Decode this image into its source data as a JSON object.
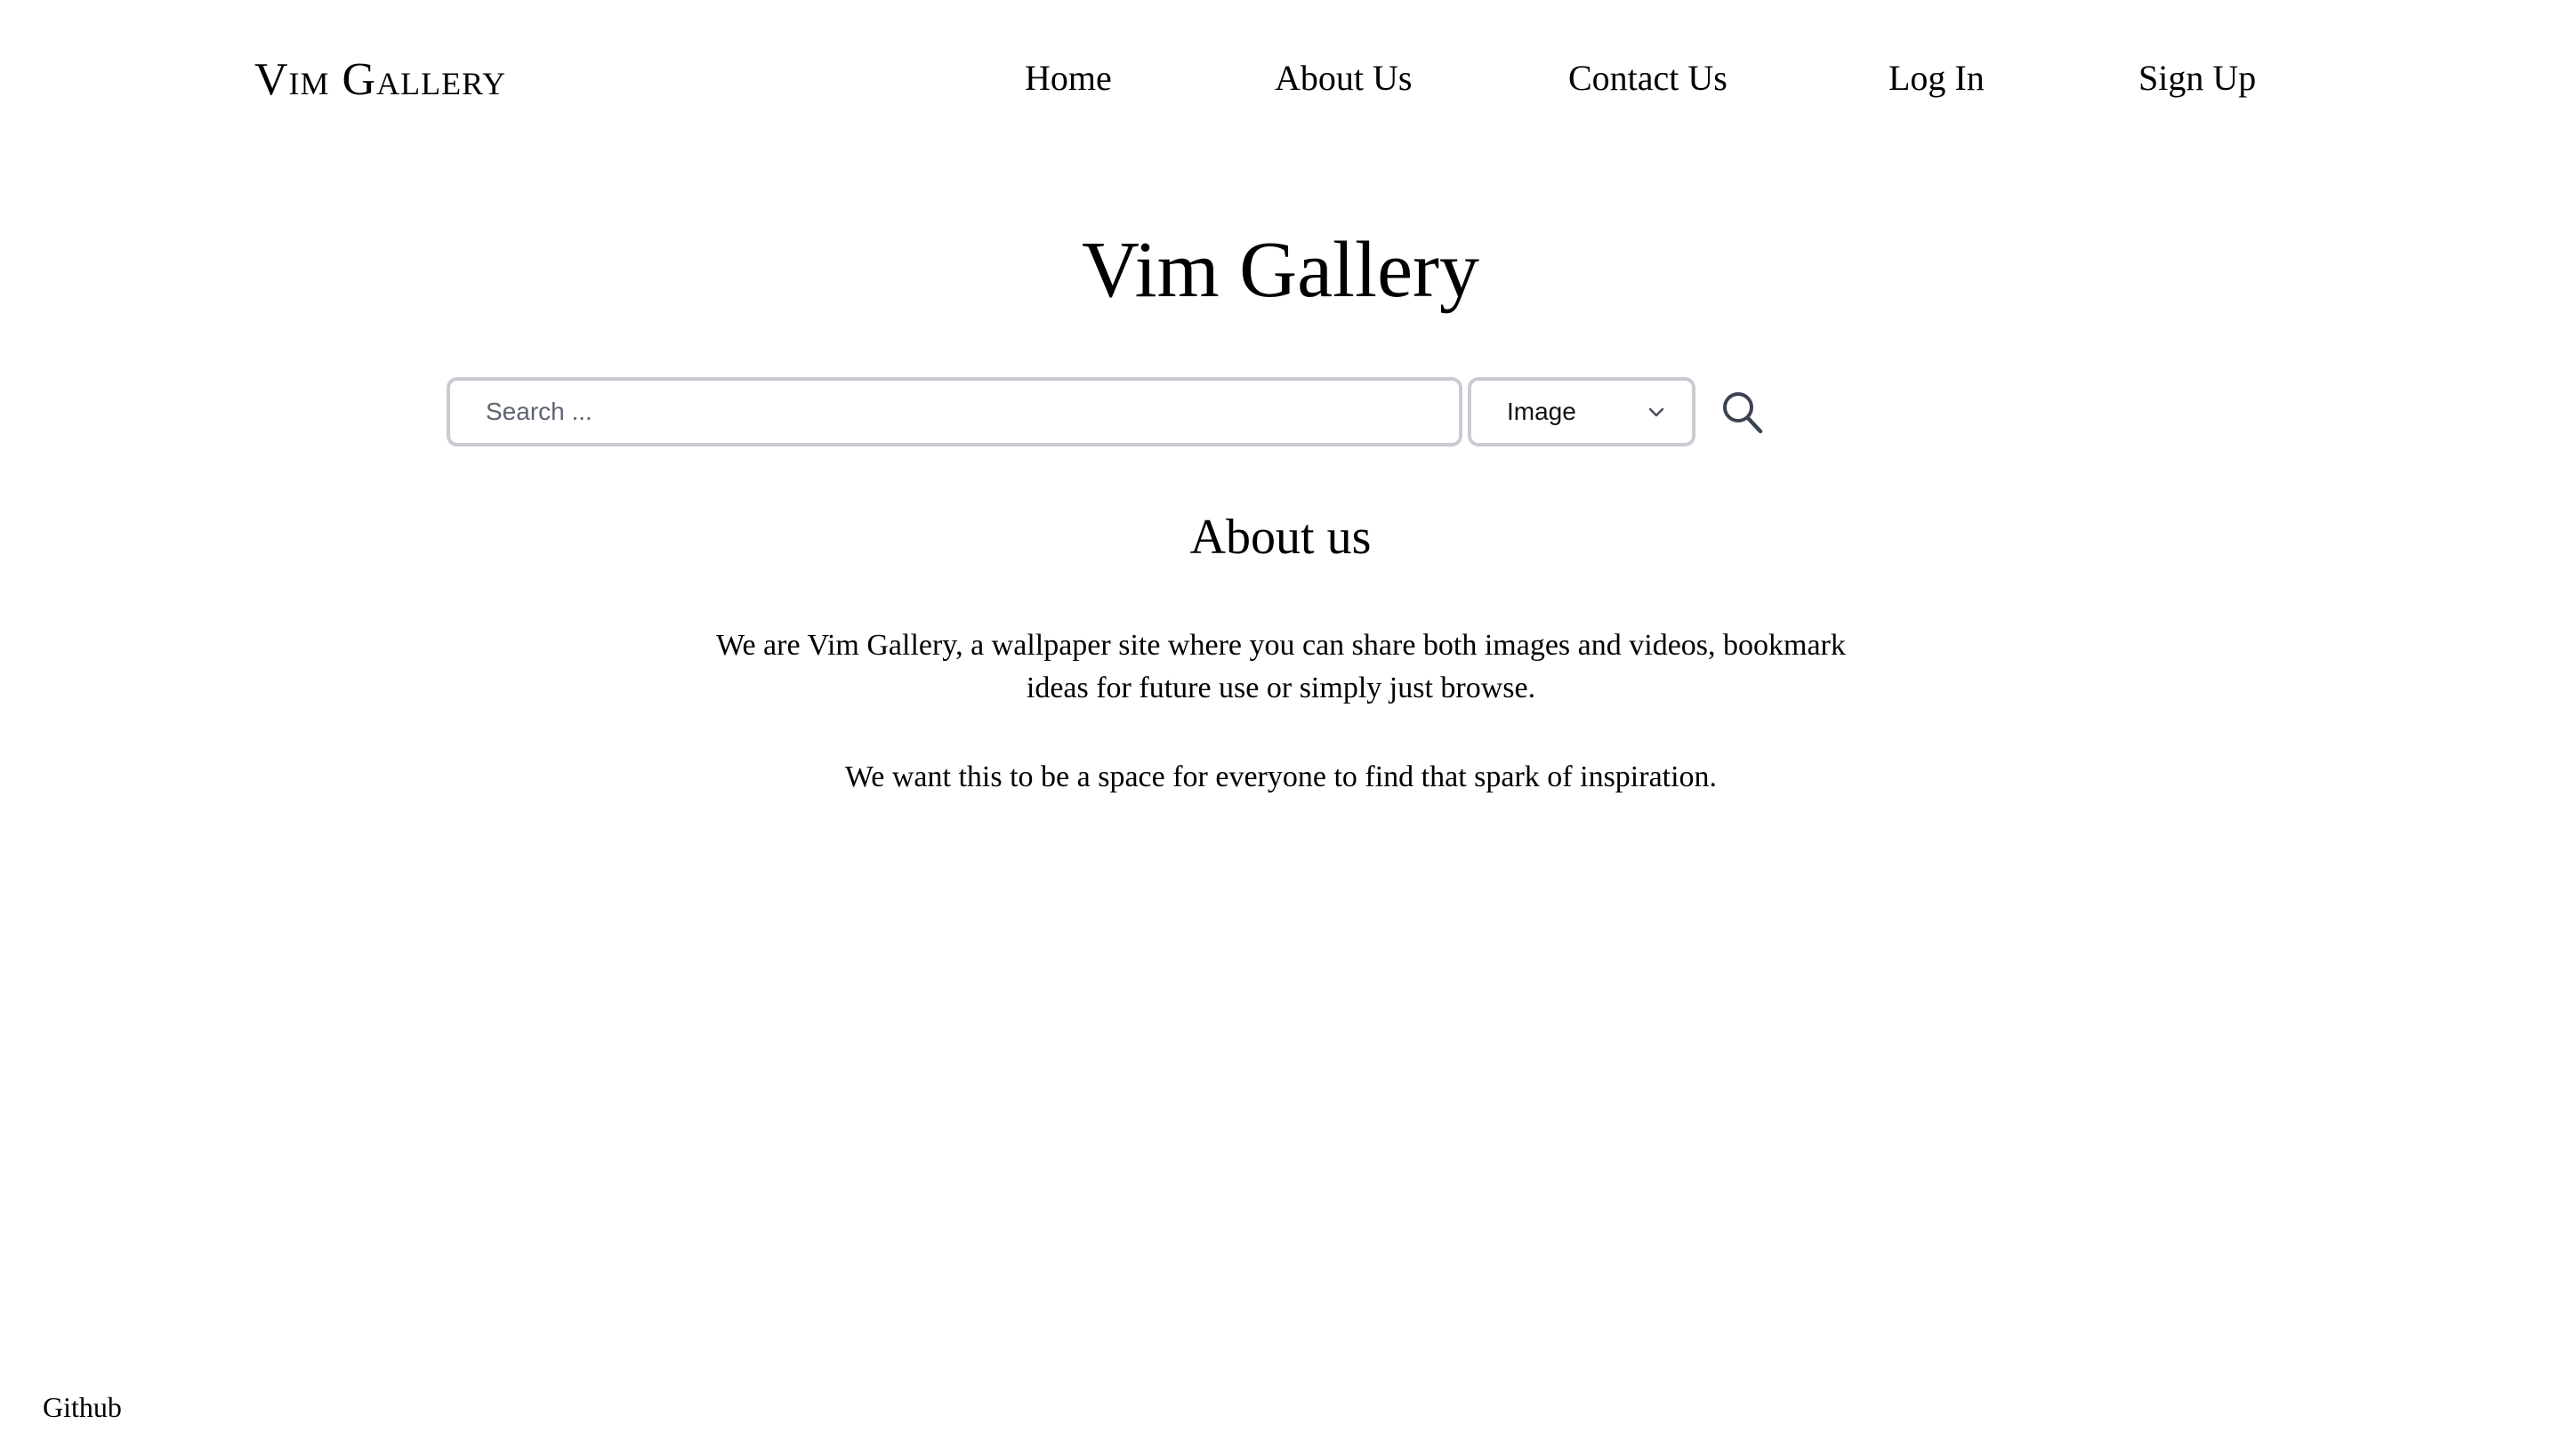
{
  "header": {
    "logo": "Vim Gallery",
    "nav": [
      {
        "label": "Home"
      },
      {
        "label": "About Us"
      },
      {
        "label": "Contact Us"
      },
      {
        "label": "Log In"
      },
      {
        "label": "Sign Up"
      }
    ]
  },
  "hero": {
    "title": "Vim Gallery"
  },
  "search": {
    "placeholder": "Search ...",
    "value": "",
    "type_selected": "Image",
    "icon": "search-icon"
  },
  "about": {
    "heading": "About us",
    "paragraphs": [
      "We are Vim Gallery, a wallpaper site where you can share both images and videos, bookmark ideas for future use or simply just browse.",
      "We want this to be a space for everyone to find that spark of inspiration."
    ]
  },
  "footer": {
    "github_label": "Github"
  }
}
